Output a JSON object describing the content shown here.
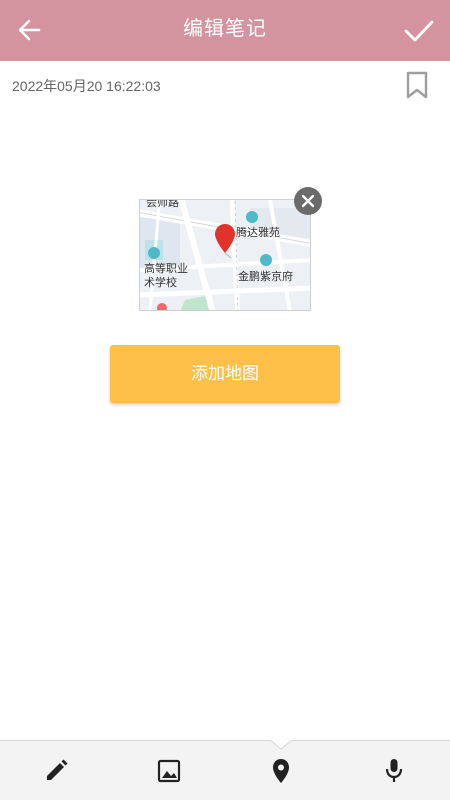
{
  "header": {
    "title": "编辑笔记",
    "back_icon": "arrow-left-icon",
    "confirm_icon": "check-icon",
    "background": "#d4949f"
  },
  "note": {
    "datetime": "2022年05月20 16:22:03",
    "bookmark_icon": "bookmark-icon"
  },
  "map_attachment": {
    "labels": {
      "top_partial": "会师路",
      "complex": "腾达雅苑",
      "school_line1": "高等职业",
      "school_line2": "术学校",
      "residence": "金鹏紫京府"
    },
    "close_icon": "close-icon"
  },
  "add_map_button": {
    "label": "添加地图",
    "color": "#ffc04a"
  },
  "toolbar": {
    "items": [
      {
        "icon": "pencil-icon"
      },
      {
        "icon": "image-icon"
      },
      {
        "icon": "location-pin-icon"
      },
      {
        "icon": "microphone-icon"
      }
    ]
  }
}
